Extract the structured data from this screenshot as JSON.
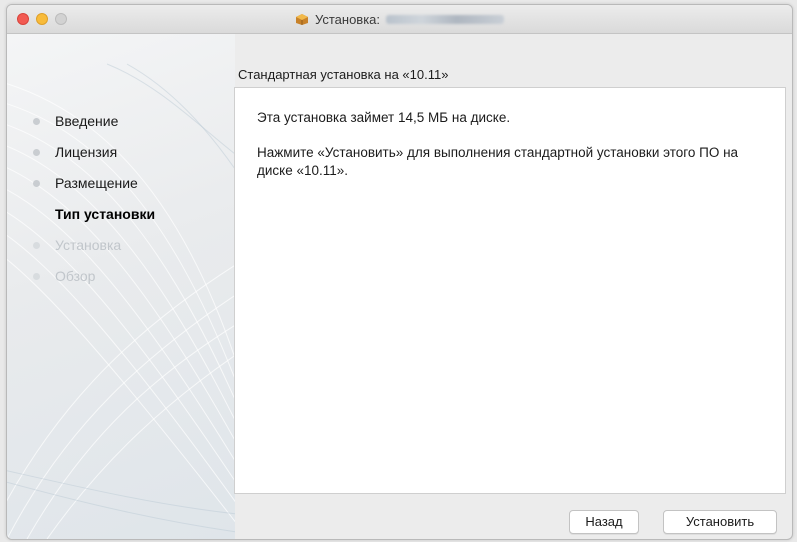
{
  "window": {
    "title": "Установка:",
    "title_obscured": true
  },
  "header": {
    "subtitle": "Стандартная установка на «10.11»"
  },
  "sidebar": {
    "steps": [
      {
        "label": "Введение",
        "state": "done"
      },
      {
        "label": "Лицензия",
        "state": "done"
      },
      {
        "label": "Размещение",
        "state": "done"
      },
      {
        "label": "Тип установки",
        "state": "current"
      },
      {
        "label": "Установка",
        "state": "future"
      },
      {
        "label": "Обзор",
        "state": "future"
      }
    ]
  },
  "content": {
    "size_text": "Эта установка займет 14,5 МБ на диске.",
    "instruction_text": "Нажмите «Установить» для выполнения стандартной установки этого ПО на диске «10.11»."
  },
  "buttons": {
    "back_label": "Назад",
    "install_label": "Установить"
  },
  "colors": {
    "close": "#f25a52",
    "minimize": "#f8bb3a",
    "maximize": "#d2d2d2"
  },
  "icons": [
    "package-icon"
  ]
}
